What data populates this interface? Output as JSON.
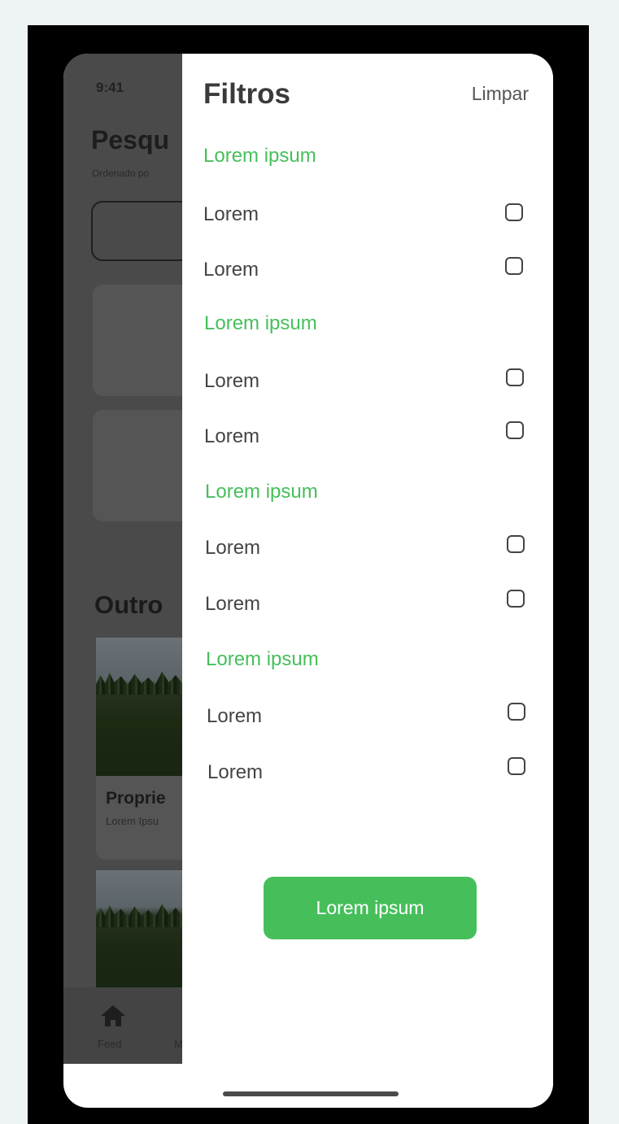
{
  "status_bar": {
    "time": "9:41"
  },
  "background_screen": {
    "title": "Pesqu",
    "subtitle": "Ordenado po",
    "section_title": "Outro",
    "property_card": {
      "title": "Proprie",
      "subtitle": "Lorem Ipsu"
    },
    "tab_bar": {
      "items": [
        {
          "label": "Feed"
        },
        {
          "label": "M"
        }
      ]
    }
  },
  "filters": {
    "title": "Filtros",
    "clear_label": "Limpar",
    "groups": [
      {
        "label": "Lorem ipsum",
        "options": [
          {
            "label": "Lorem",
            "checked": false
          },
          {
            "label": "Lorem",
            "checked": false
          }
        ]
      },
      {
        "label": "Lorem ipsum",
        "options": [
          {
            "label": "Lorem",
            "checked": false
          },
          {
            "label": "Lorem",
            "checked": false
          }
        ]
      },
      {
        "label": "Lorem ipsum",
        "options": [
          {
            "label": "Lorem",
            "checked": false
          },
          {
            "label": "Lorem",
            "checked": false
          }
        ]
      },
      {
        "label": "Lorem ipsum",
        "options": [
          {
            "label": "Lorem",
            "checked": false
          },
          {
            "label": "Lorem",
            "checked": false
          }
        ]
      }
    ],
    "apply_label": "Lorem ipsum"
  },
  "colors": {
    "accent": "#46bf5b",
    "overlay": "#4a4a4a",
    "text": "#444444"
  }
}
